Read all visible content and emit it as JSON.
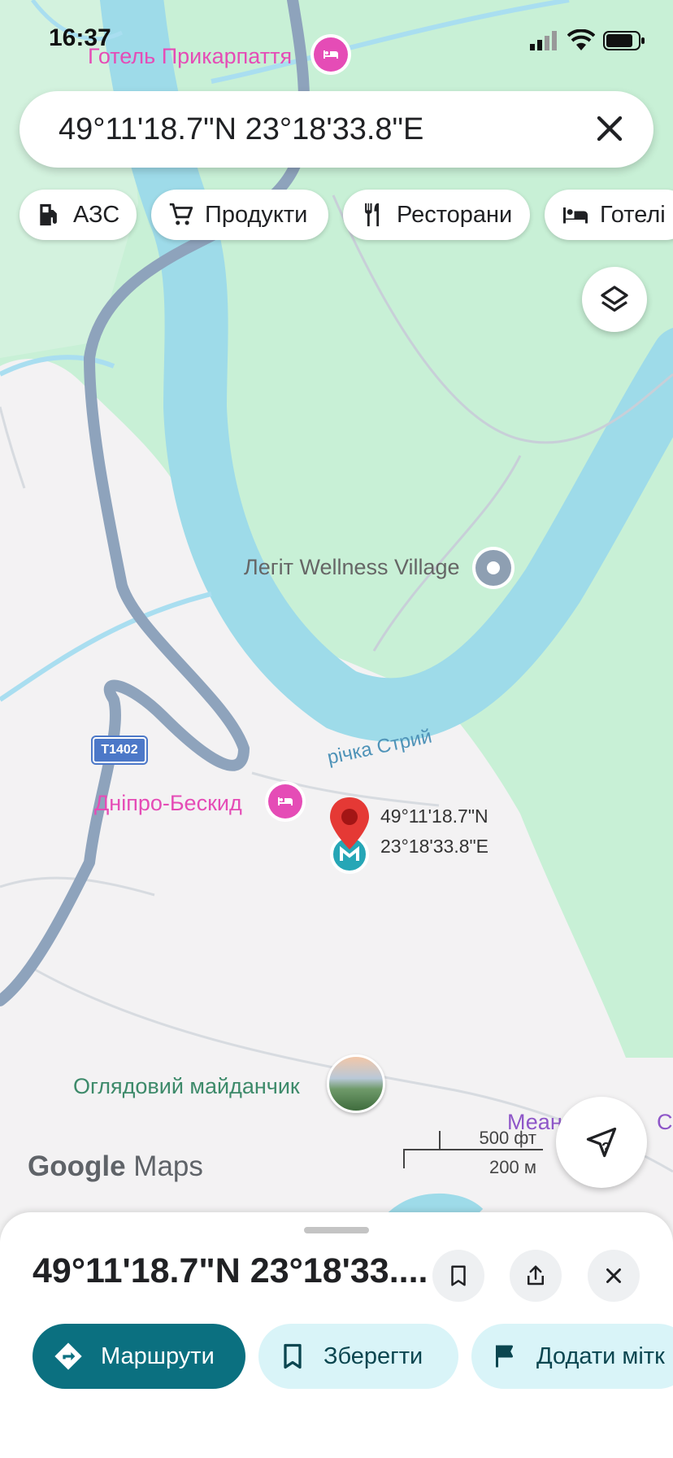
{
  "status_bar": {
    "time": "16:37"
  },
  "search": {
    "query": "49°11'18.7\"N 23°18'33.8\"E"
  },
  "chips": [
    {
      "label": "АЗС",
      "icon": "gas-station-icon"
    },
    {
      "label": "Продукти",
      "icon": "cart-icon"
    },
    {
      "label": "Ресторани",
      "icon": "fork-knife-icon"
    },
    {
      "label": "Готелі",
      "icon": "bed-icon"
    }
  ],
  "map": {
    "labels": {
      "hotel_top": "Готель Прикарпаття",
      "wellness": "Легіт Wellness Village",
      "river": "річка Стрий",
      "road_shield": "T1402",
      "hotel_dnipro": "Дніпро-Бескид",
      "viewpoint": "Оглядовий майданчик",
      "purple_place": "Меан",
      "purple_place_end": "С",
      "pin_lat": "49°11'18.7\"N",
      "pin_lon": "23°18'33.8\"E"
    },
    "scale": {
      "feet": "500 фт",
      "meters": "200 м"
    },
    "brand": {
      "google": "Google",
      "maps": "Maps"
    },
    "colors": {
      "water": "#9edbe9",
      "park": "#c8f0d6",
      "land": "#f3f2f3",
      "road": "#8ea3bc",
      "hotel": "#e54cb6",
      "pin": "#e53935"
    }
  },
  "sheet": {
    "title": "49°11'18.7\"N 23°18'33....",
    "actions": [
      {
        "label": "Маршрути",
        "icon": "directions-icon"
      },
      {
        "label": "Зберегти",
        "icon": "bookmark-icon"
      },
      {
        "label": "Додати мітк",
        "icon": "flag-icon"
      }
    ]
  }
}
